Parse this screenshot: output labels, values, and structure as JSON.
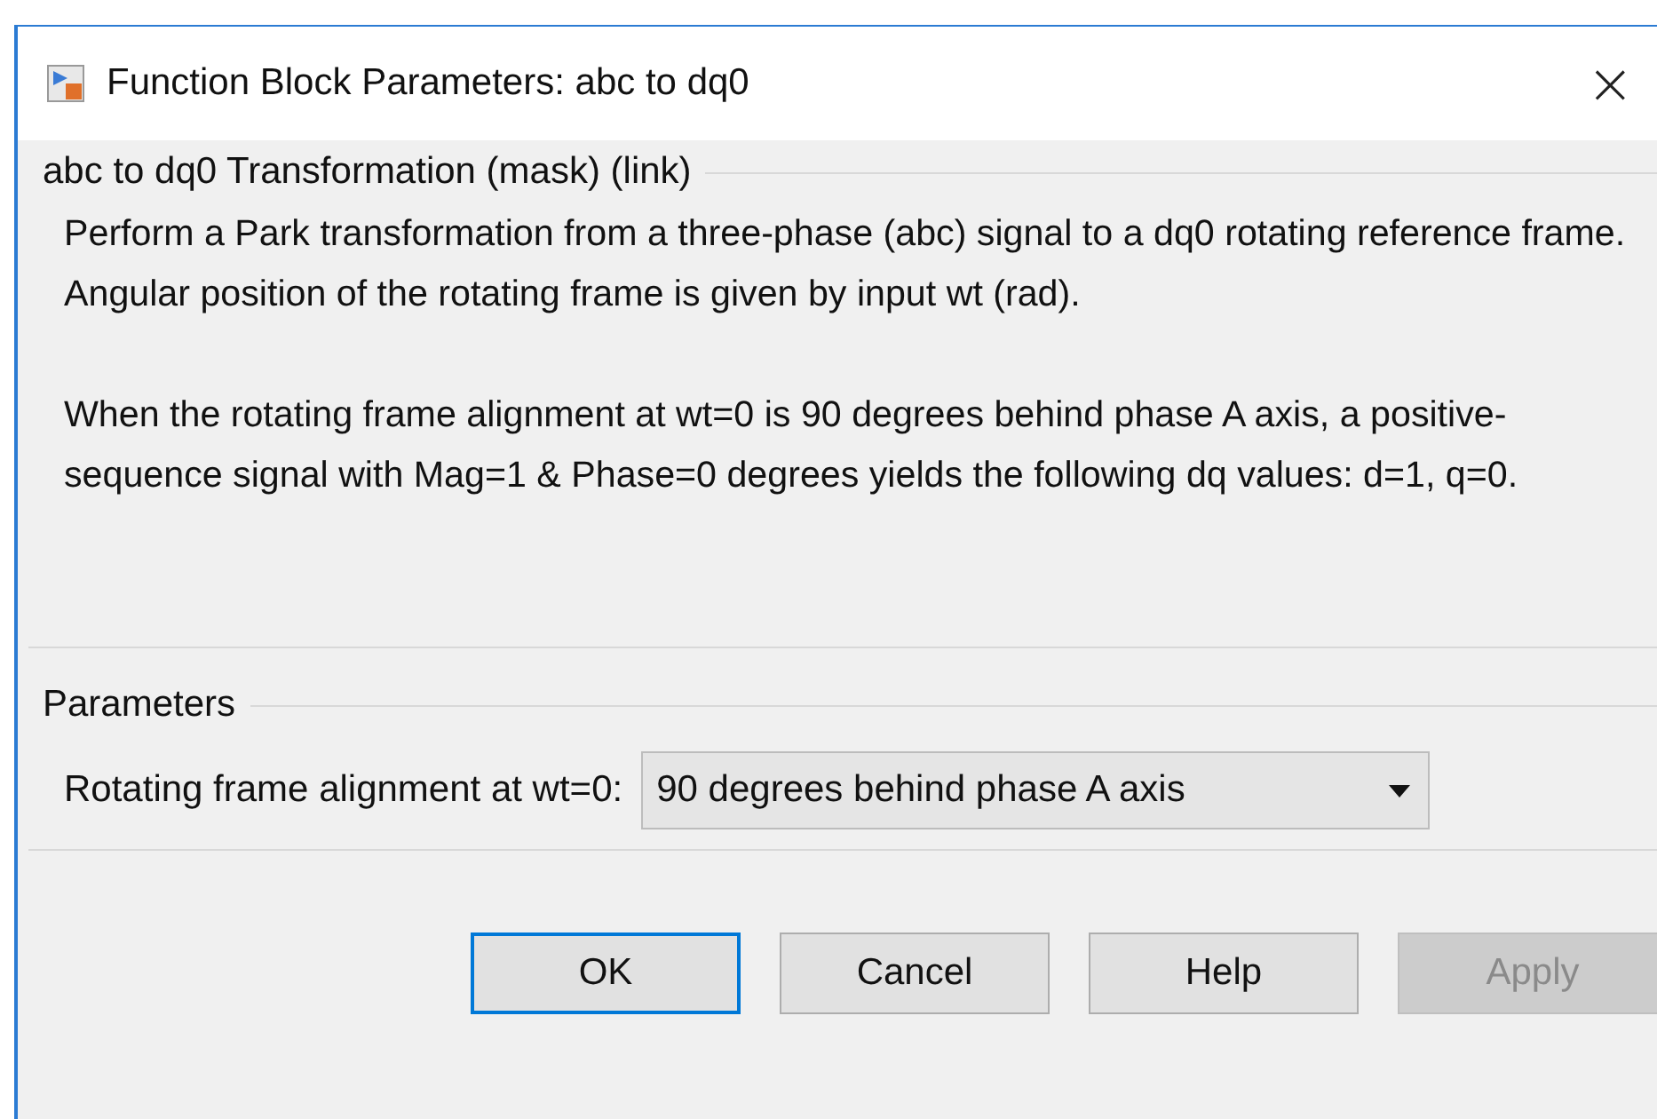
{
  "window": {
    "title": "Function Block Parameters: abc to dq0",
    "close": "×"
  },
  "description_group": {
    "title": "abc to dq0 Transformation (mask) (link)",
    "paragraphs": [
      "Perform a Park transformation from a three-phase (abc) signal to a dq0 rotating reference frame. Angular position of the rotating frame is given by input wt (rad).",
      "When the rotating frame alignment at wt=0 is 90 degrees behind phase A axis, a positive-sequence signal with Mag=1 & Phase=0 degrees yields the following dq values: d=1, q=0."
    ]
  },
  "parameters_group": {
    "title": "Parameters",
    "fields": [
      {
        "label": "Rotating frame alignment at wt=0:",
        "value": "90 degrees behind phase A axis"
      }
    ]
  },
  "buttons": [
    {
      "label": "OK",
      "default": true,
      "disabled": false
    },
    {
      "label": "Cancel",
      "default": false,
      "disabled": false
    },
    {
      "label": "Help",
      "default": false,
      "disabled": false
    },
    {
      "label": "Apply",
      "default": false,
      "disabled": true
    }
  ]
}
